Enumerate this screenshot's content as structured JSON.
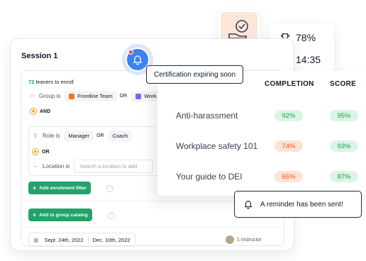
{
  "session": {
    "title": "Session 1",
    "learners_count": "72",
    "learners_text": "leaners to enroll",
    "group_label": "Group is",
    "group_chips": [
      {
        "label": "Frontline Team",
        "color": "#f97316"
      },
      {
        "label": "Work",
        "color": "#8b5cf6"
      }
    ],
    "or_label": "OR",
    "and_label": "AND",
    "role_label": "Role is",
    "role_chips": [
      "Manager",
      "Coach"
    ],
    "or_label_2": "OR",
    "location_label": "Location is",
    "location_placeholder": "Search a location to add",
    "add_filter_label": "Add enrollment filter",
    "add_catalog_label": "Add to group catalog",
    "start_date": "Sept. 24th, 2022",
    "end_date": "Dec. 10th, 2022",
    "instructor_text": "1 instructor"
  },
  "notification": {
    "tooltip": "Certification expiring soon"
  },
  "stats": {
    "score_value": "78%",
    "time_value": "14:35"
  },
  "results": {
    "col_completion": "COMPLETION",
    "col_score": "SCORE",
    "rows": [
      {
        "name": "Anti-harassment",
        "completion": "92%",
        "score": "95%"
      },
      {
        "name": "Workplace safety 101",
        "completion": "74%",
        "score": "93%"
      },
      {
        "name": "Your guide to DEI",
        "completion": "65%",
        "score": "87%"
      }
    ]
  },
  "toast": {
    "text": "A reminder has been sent!"
  },
  "colors": {
    "accent_green": "#22a36a",
    "pill_green": "#16a34a",
    "pill_orange": "#ea580c",
    "bell_blue": "#3b82f6"
  }
}
